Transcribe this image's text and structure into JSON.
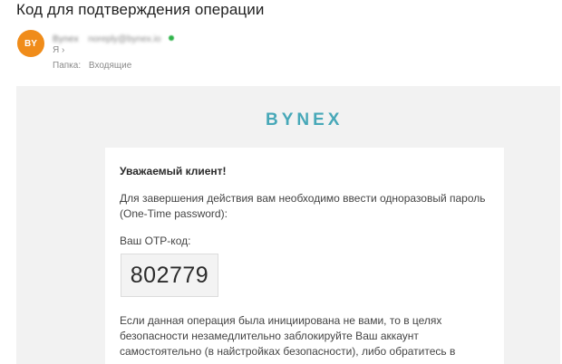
{
  "email": {
    "subject": "Код для подтверждения операции",
    "sender": {
      "avatar_initials": "BY",
      "avatar_color": "#f08c1a",
      "name": "Bynex",
      "email": "noreply@bynex.io",
      "online_color": "#2fb34a"
    },
    "to": "Я ›",
    "folder_label": "Папка:",
    "folder_value": "Входящие"
  },
  "body": {
    "logo_text": "BYNEX",
    "logo_color": "#47a8b8",
    "greeting": "Уважаемый клиент!",
    "intro": "Для завершения действия вам необходимо ввести одноразовый пароль (One-Time password):",
    "otp_label": "Ваш OTP-код:",
    "otp_code": "802779",
    "warning": "Если данная операция была инициирована не вами, то в целях безопасности незамедлительно заблокируйте Ваш аккаунт самостоятельно (в найстройках безопасности), либо обратитесь в"
  }
}
